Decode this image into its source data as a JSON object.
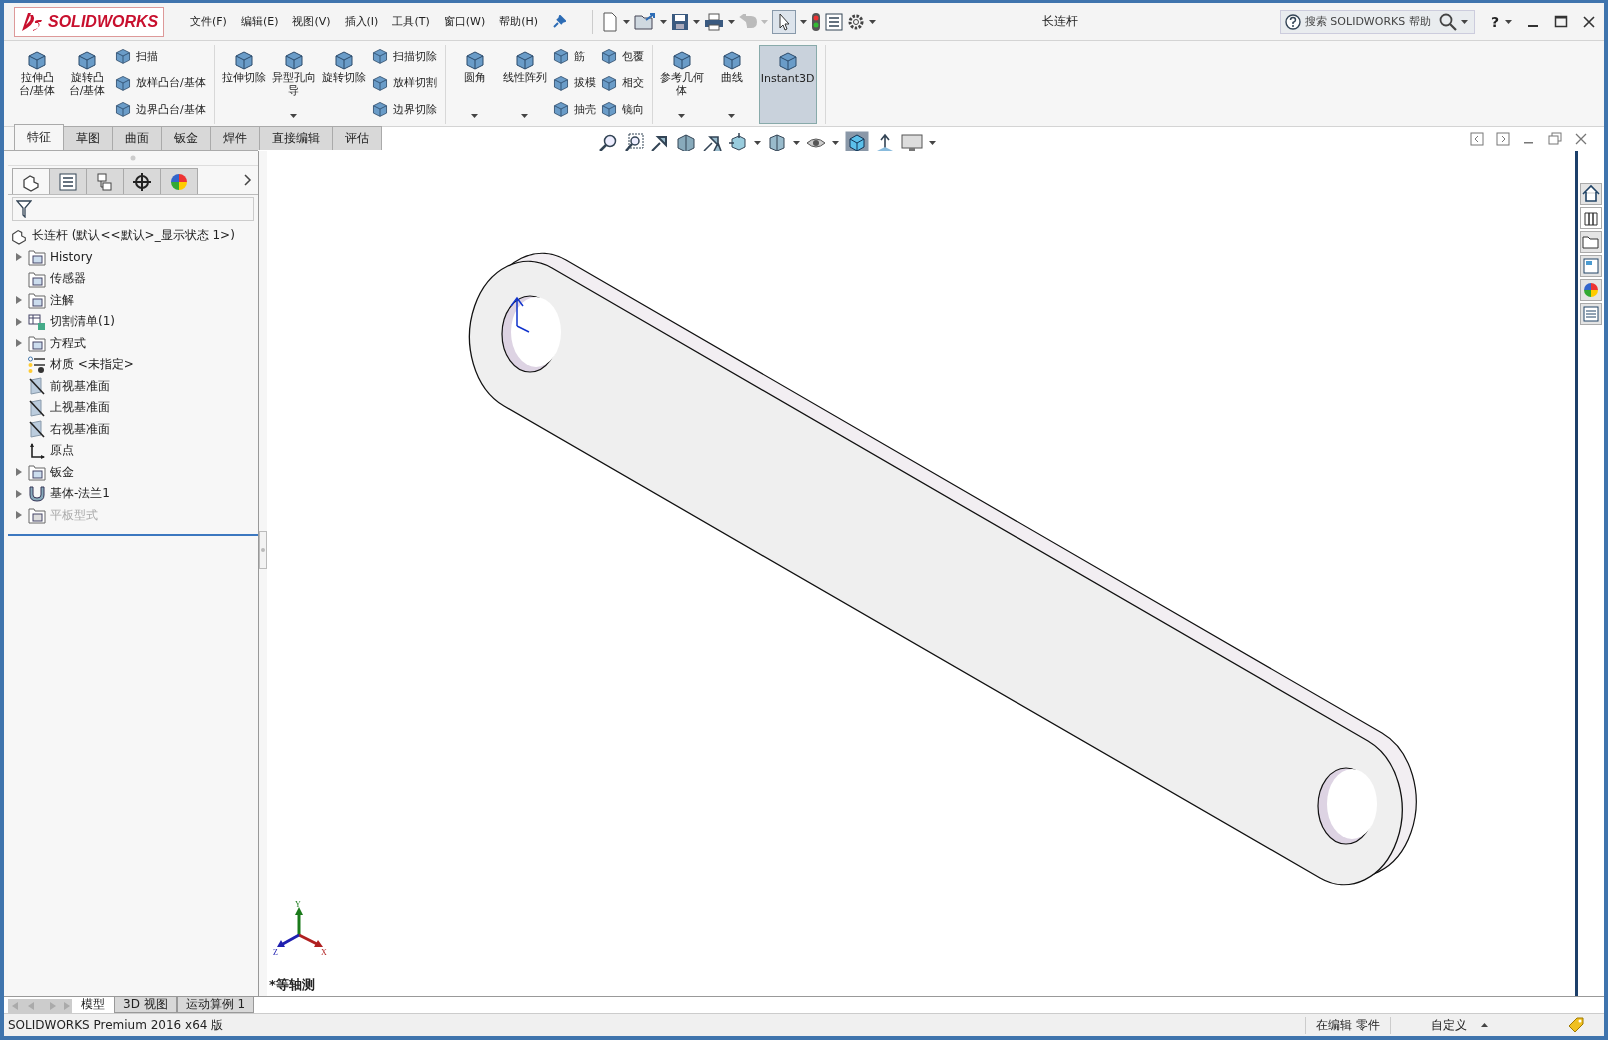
{
  "app": {
    "logo": "SOLIDWORKS"
  },
  "menu": [
    {
      "label": "文件(F)"
    },
    {
      "label": "编辑(E)"
    },
    {
      "label": "视图(V)"
    },
    {
      "label": "插入(I)"
    },
    {
      "label": "工具(T)"
    },
    {
      "label": "窗口(W)"
    },
    {
      "label": "帮助(H)"
    }
  ],
  "document_title": "长连杆",
  "search": {
    "placeholder": "搜索 SOLIDWORKS 帮助"
  },
  "help": "?",
  "ribbon": [
    {
      "large": [
        {
          "label": "拉伸凸台/基体",
          "dropdown": false,
          "selected": false
        },
        {
          "label": "旋转凸台/基体",
          "dropdown": false,
          "selected": false
        }
      ],
      "columns": [
        [
          {
            "label": "扫描"
          },
          {
            "label": "放样凸台/基体"
          },
          {
            "label": "边界凸台/基体"
          }
        ]
      ]
    },
    {
      "large": [
        {
          "label": "拉伸切除",
          "dropdown": false,
          "selected": false
        },
        {
          "label": "异型孔向导",
          "dropdown": true,
          "selected": false
        },
        {
          "label": "旋转切除",
          "dropdown": false,
          "selected": false
        }
      ],
      "columns": [
        [
          {
            "label": "扫描切除"
          },
          {
            "label": "放样切割"
          },
          {
            "label": "边界切除"
          }
        ]
      ]
    },
    {
      "large": [
        {
          "label": "圆角",
          "dropdown": true,
          "selected": false
        },
        {
          "label": "线性阵列",
          "dropdown": true,
          "selected": false
        }
      ],
      "columns": [
        [
          {
            "label": "筋"
          },
          {
            "label": "拔模"
          },
          {
            "label": "抽壳"
          }
        ],
        [
          {
            "label": "包覆"
          },
          {
            "label": "相交"
          },
          {
            "label": "镜向"
          }
        ]
      ]
    },
    {
      "large": [
        {
          "label": "参考几何体",
          "dropdown": true,
          "selected": false
        },
        {
          "label": "曲线",
          "dropdown": true,
          "selected": false
        },
        {
          "label": "Instant3D",
          "dropdown": false,
          "selected": true
        }
      ]
    }
  ],
  "command_tabs": [
    {
      "label": "特征",
      "selected": true
    },
    {
      "label": "草图",
      "selected": false
    },
    {
      "label": "曲面",
      "selected": false
    },
    {
      "label": "钣金",
      "selected": false
    },
    {
      "label": "焊件",
      "selected": false
    },
    {
      "label": "直接编辑",
      "selected": false
    },
    {
      "label": "评估",
      "selected": false
    }
  ],
  "panel_tabs": [
    {
      "kind": "features",
      "selected": true
    },
    {
      "kind": "properties",
      "selected": false
    },
    {
      "kind": "configurations",
      "selected": false
    },
    {
      "kind": "dimxpert",
      "selected": false
    },
    {
      "kind": "appearance",
      "selected": false
    }
  ],
  "feature_tree": {
    "root": "长连杆 (默认<<默认>_显示状态 1>)",
    "items": [
      {
        "label": "History",
        "kind": "history",
        "expandable": true,
        "disabled": false
      },
      {
        "label": "传感器",
        "kind": "sensor",
        "expandable": false,
        "disabled": false
      },
      {
        "label": "注解",
        "kind": "annotation",
        "expandable": true,
        "disabled": false
      },
      {
        "label": "切割清单(1)",
        "kind": "cutlist",
        "expandable": true,
        "disabled": false
      },
      {
        "label": "方程式",
        "kind": "equation",
        "expandable": true,
        "disabled": false
      },
      {
        "label": "材质 <未指定>",
        "kind": "material",
        "expandable": false,
        "disabled": false
      },
      {
        "label": "前视基准面",
        "kind": "plane",
        "expandable": false,
        "disabled": false
      },
      {
        "label": "上视基准面",
        "kind": "plane",
        "expandable": false,
        "disabled": false
      },
      {
        "label": "右视基准面",
        "kind": "plane",
        "expandable": false,
        "disabled": false
      },
      {
        "label": "原点",
        "kind": "origin",
        "expandable": false,
        "disabled": false
      },
      {
        "label": "钣金",
        "kind": "sheetmetal",
        "expandable": true,
        "disabled": false
      },
      {
        "label": "基体-法兰1",
        "kind": "flange",
        "expandable": true,
        "disabled": false
      },
      {
        "label": "平板型式",
        "kind": "flat",
        "expandable": true,
        "disabled": true
      }
    ]
  },
  "viewport": {
    "triad": {
      "y": "Y",
      "z": "Z",
      "x": "X"
    },
    "view_label": "*等轴测"
  },
  "bottom_tabs": [
    {
      "label": "模型",
      "selected": true
    },
    {
      "label": "3D 视图",
      "selected": false
    },
    {
      "label": "运动算例 1",
      "selected": false
    }
  ],
  "status_bar": {
    "product": "SOLIDWORKS Premium 2016 x64 版",
    "mode": "在编辑 零件",
    "units": "自定义"
  }
}
